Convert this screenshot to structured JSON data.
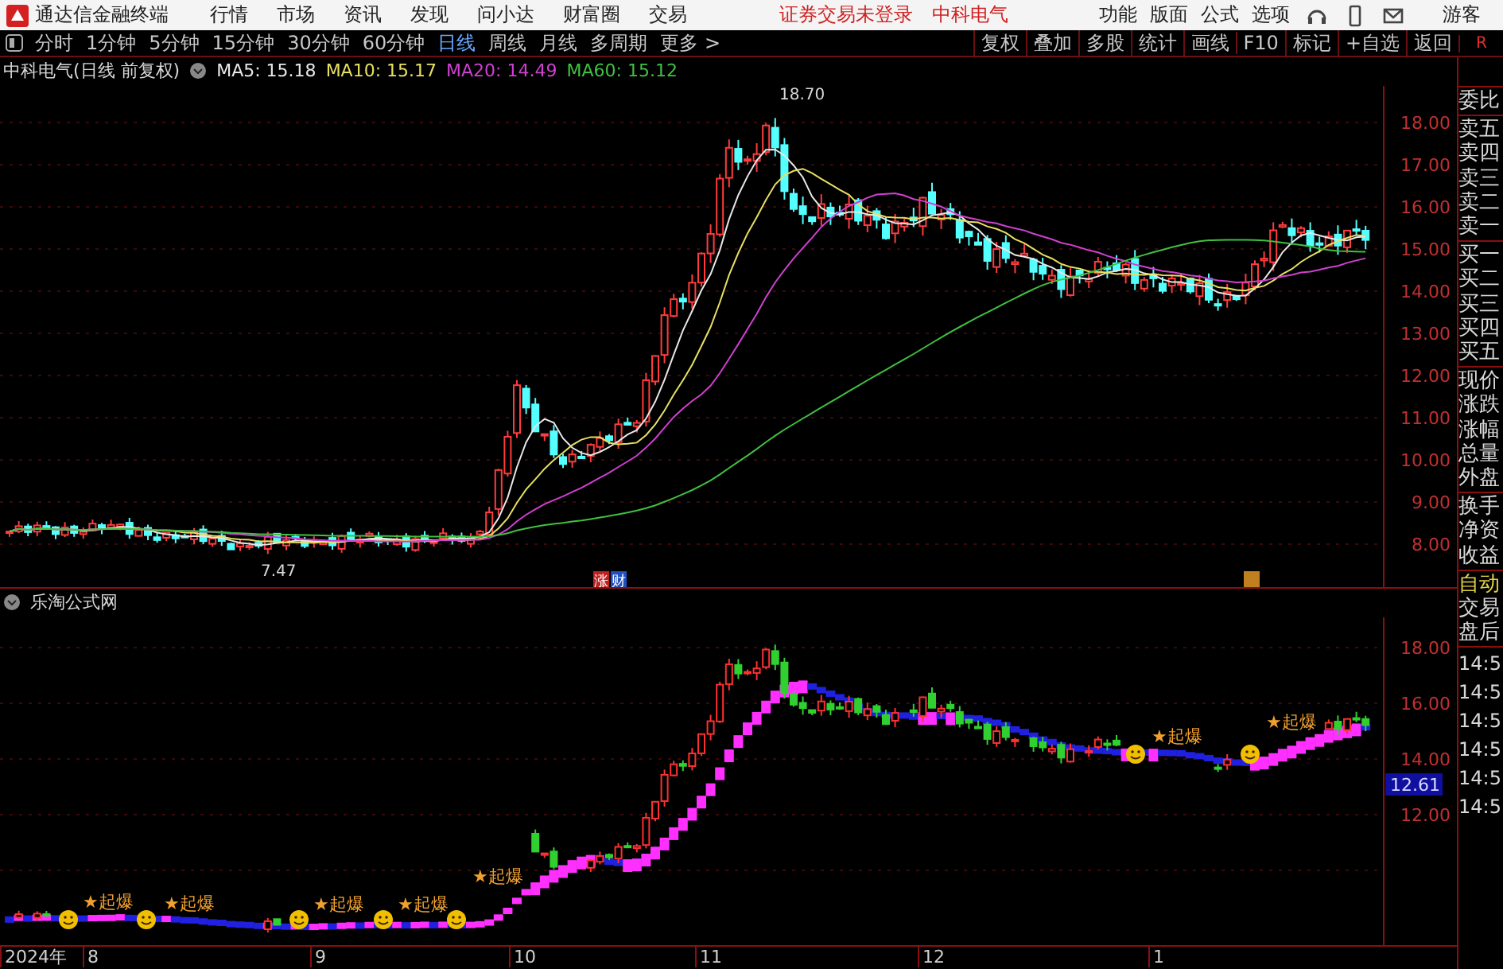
{
  "app": {
    "title": "通达信金融终端",
    "menu": [
      "行情",
      "市场",
      "资讯",
      "发现",
      "问小达",
      "财富圈",
      "交易"
    ],
    "status": "证券交易未登录",
    "stock": "中科电气",
    "tools": [
      "功能",
      "版面",
      "公式",
      "选项"
    ],
    "user": "游客"
  },
  "periods": [
    {
      "label": "分时",
      "selected": false
    },
    {
      "label": "1分钟",
      "selected": false
    },
    {
      "label": "5分钟",
      "selected": false
    },
    {
      "label": "15分钟",
      "selected": false
    },
    {
      "label": "30分钟",
      "selected": false
    },
    {
      "label": "60分钟",
      "selected": false
    },
    {
      "label": "日线",
      "selected": true
    },
    {
      "label": "周线",
      "selected": false
    },
    {
      "label": "月线",
      "selected": false
    },
    {
      "label": "多周期",
      "selected": false
    },
    {
      "label": "更多 >",
      "selected": false
    }
  ],
  "actions": [
    "复权",
    "叠加",
    "多股",
    "统计",
    "画线",
    "F10",
    "标记",
    "+自选",
    "返回"
  ],
  "corner": "R",
  "main_chart": {
    "title": "中科电气(日线 前复权)",
    "averages": [
      {
        "label": "MA5: 15.18",
        "color": "#e8e8e8"
      },
      {
        "label": "MA10: 15.17",
        "color": "#e8e060"
      },
      {
        "label": "MA20: 14.49",
        "color": "#d040d0"
      },
      {
        "label": "MA60: 15.12",
        "color": "#40c040"
      }
    ],
    "y_labels": [
      "18.00",
      "17.00",
      "16.00",
      "15.00",
      "14.00",
      "13.00",
      "12.00",
      "11.00",
      "10.00",
      "9.00",
      "8.00"
    ],
    "high_note": "18.70",
    "low_note": "7.47",
    "badges": [
      {
        "label": "涨",
        "color": "#c02020"
      },
      {
        "label": "财",
        "color": "#2050c0"
      }
    ]
  },
  "indicator": {
    "title": "乐淘公式网",
    "y_labels": [
      "18.00",
      "16.00",
      "14.00",
      "12.00"
    ],
    "current_value": "12.61",
    "signals": [
      "★起爆",
      "★起爆",
      "★起爆",
      "★起爆",
      "★起爆",
      "★起爆",
      "★起爆"
    ]
  },
  "dates": [
    "2024年",
    "8",
    "9",
    "10",
    "11",
    "12",
    "1"
  ],
  "quote_panel": {
    "groups": [
      [
        "委比"
      ],
      [
        "卖五",
        "卖四",
        "卖三",
        "卖二",
        "卖一"
      ],
      [
        "买一",
        "买二",
        "买三",
        "买四",
        "买五"
      ],
      [
        "现价",
        "涨跌",
        "涨幅",
        "总量",
        "外盘"
      ],
      [
        "换手",
        "净资",
        "收益"
      ]
    ],
    "mode": "自动",
    "states": [
      "交易",
      "盘后"
    ],
    "times": [
      "14:5",
      "14:5",
      "14:5",
      "14:5",
      "14:5",
      "14:5"
    ]
  }
}
